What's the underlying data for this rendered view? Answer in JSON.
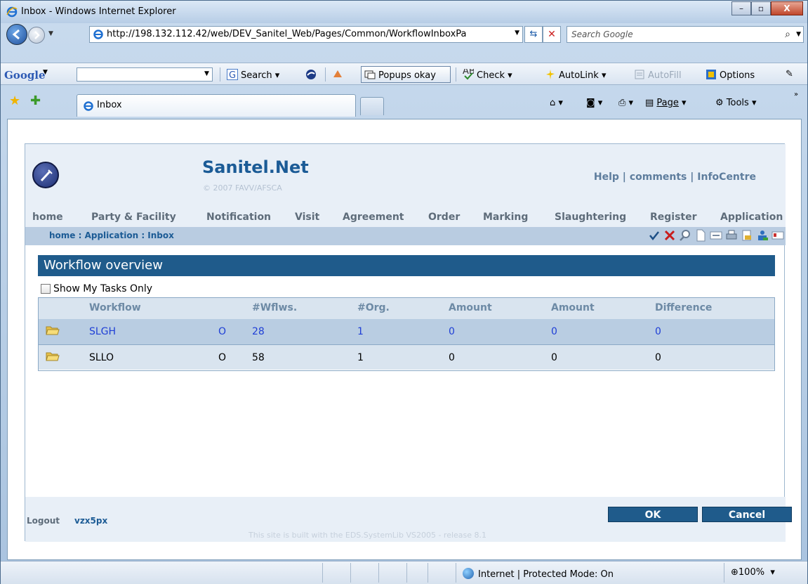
{
  "window": {
    "title": "Inbox - Windows Internet Explorer",
    "minimize": "–",
    "maximize": "▫",
    "close": "X"
  },
  "navbar": {
    "url": "http://198.132.112.42/web/DEV_Sanitel_Web/Pages/Common/WorkflowInboxPa",
    "search_placeholder": "Search Google"
  },
  "google_toolbar": {
    "logo": "Google",
    "search_label": "Search",
    "popups_label": "Popups okay",
    "check_label": "Check",
    "autolink_label": "AutoLink",
    "autofill_label": "AutoFill",
    "options_label": "Options"
  },
  "tabs": [
    {
      "label": "Inbox"
    }
  ],
  "command_bar": {
    "page_label": "Page",
    "tools_label": "Tools"
  },
  "app": {
    "brand": "Sanitel.Net",
    "copyright": "© 2007 FAVV/AFSCA",
    "top_links": {
      "help": "Help",
      "comments": "comments",
      "infocentre": "InfoCentre",
      "sep": " | "
    },
    "menu": [
      "home",
      "Party & Facility",
      "Notification",
      "Visit",
      "Agreement",
      "Order",
      "Marking",
      "Slaughtering",
      "Register",
      "Application"
    ],
    "breadcrumb": {
      "home": "home",
      "application": "Application",
      "inbox": "Inbox",
      "sep": " : "
    },
    "panel_title": "Workflow overview",
    "show_my_tasks_label": "Show My Tasks Only",
    "grid": {
      "headers": [
        "Workflow",
        "#Wflws.",
        "#Org.",
        "Amount",
        "Amount",
        "Difference"
      ],
      "rows": [
        {
          "workflow": "SLGH",
          "flag": "O",
          "wflws": "28",
          "org": "1",
          "amount1": "0",
          "amount2": "0",
          "difference": "0"
        },
        {
          "workflow": "SLLO",
          "flag": "O",
          "wflws": "58",
          "org": "1",
          "amount1": "0",
          "amount2": "0",
          "difference": "0"
        }
      ]
    },
    "footer": {
      "logout_label": "Logout",
      "user": "vzx5px",
      "ok_label": "OK",
      "cancel_label": "Cancel",
      "built_text": "This site is built with the EDS.SystemLib VS2005 - release 8.1"
    }
  },
  "status": {
    "zone": "Internet | Protected Mode: On",
    "zoom": "100%"
  }
}
